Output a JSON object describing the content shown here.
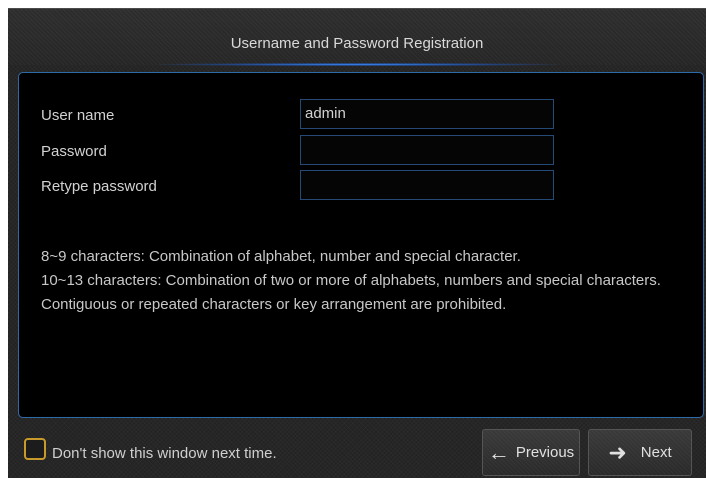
{
  "dialog": {
    "title": "Username and Password Registration"
  },
  "form": {
    "username_label": "User name",
    "username_value": "admin",
    "password_label": "Password",
    "password_value": "",
    "retype_label": "Retype password",
    "retype_value": ""
  },
  "notes": {
    "line1": "8~9 characters: Combination of alphabet, number and special character.",
    "line2": "10~13 characters: Combination of two or more of alphabets, numbers and special characters.",
    "line3": "Contiguous or repeated characters or key arrangement are prohibited."
  },
  "footer": {
    "checkbox_label": "Don't show this window next time.",
    "checkbox_checked": false,
    "previous_label": "Previous",
    "previous_icon": "arrow-left-icon",
    "next_label": "Next",
    "next_icon": "arrow-right-icon"
  },
  "colors": {
    "accent_border": "#2f6aa8",
    "checkbox_border": "#c89a2c"
  }
}
